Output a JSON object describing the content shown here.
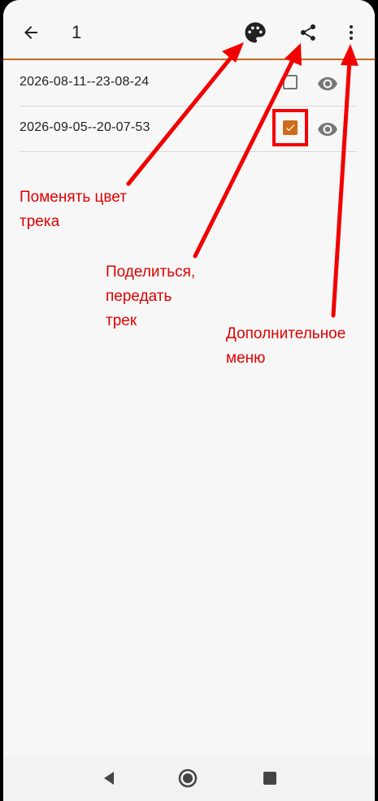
{
  "toolbar": {
    "title": "1"
  },
  "tracks": [
    {
      "name": "2026-08-11--23-08-24",
      "checked": false
    },
    {
      "name": "2026-09-05--20-07-53",
      "checked": true
    }
  ],
  "annotations": {
    "color": {
      "line1": "Поменять цвет",
      "line2": "трека"
    },
    "share": {
      "line1": "Поделиться,",
      "line2": "передать",
      "line3": "трек"
    },
    "menu": {
      "line1": "Дополнительное",
      "line2": "меню"
    }
  },
  "colors": {
    "accent": "#d06b1b",
    "annotation": "#e00000",
    "toolbar_rule": "#c8661e"
  },
  "icons": {
    "back": "arrow-back-icon",
    "palette": "palette-icon",
    "share": "share-icon",
    "more": "more-vert-icon",
    "visibility": "eye-icon"
  }
}
